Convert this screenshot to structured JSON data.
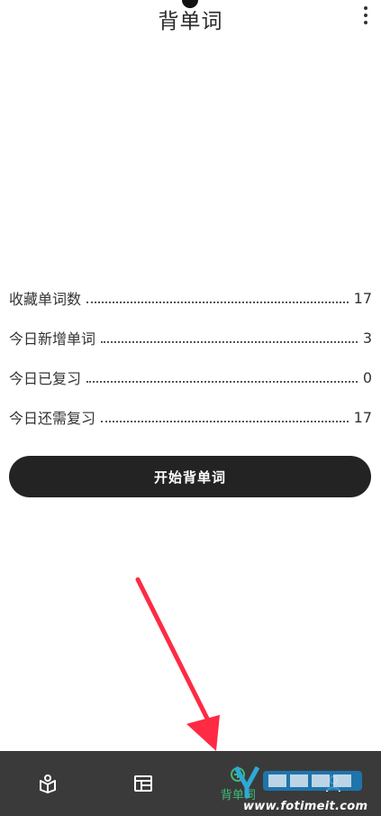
{
  "header": {
    "title": "背单词",
    "more_icon": "more-vertical-icon"
  },
  "stats": [
    {
      "label": "收藏单词数",
      "value": "17"
    },
    {
      "label": "今日新增单词",
      "value": "3"
    },
    {
      "label": "今日已复习",
      "value": "0"
    },
    {
      "label": "今日还需复习",
      "value": "17"
    }
  ],
  "start_button": {
    "label": "开始背单词"
  },
  "bottom_nav": {
    "items": [
      {
        "icon": "book-icon",
        "label": ""
      },
      {
        "icon": "table-icon",
        "label": ""
      },
      {
        "icon": "flashcard-icon",
        "label": "背单词",
        "active": true
      },
      {
        "icon": "user-icon",
        "label": ""
      }
    ],
    "active_color": "#3dbb7a",
    "background": "#3a3a3a"
  },
  "watermark": {
    "text": "www.fotimeit.com"
  },
  "annotation": {
    "arrow_color": "#ff2a44"
  }
}
